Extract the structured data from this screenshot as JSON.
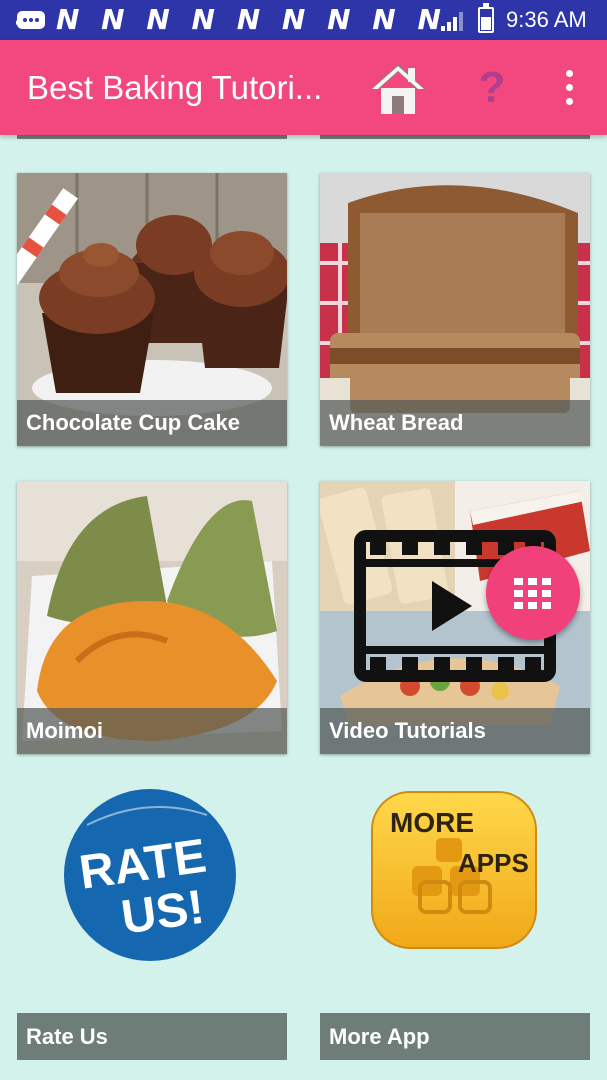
{
  "status_bar": {
    "notification_icons": "N N N N N N N N N",
    "time": "9:36 AM",
    "icons": [
      "message-icon",
      "signal-icon",
      "battery-icon"
    ]
  },
  "app_bar": {
    "title": "Best Baking Tutori...",
    "actions": [
      "home-icon",
      "help-icon",
      "more-options-icon"
    ]
  },
  "grid": [
    {
      "label": "Chocolate Cup Cake"
    },
    {
      "label": "Wheat Bread"
    },
    {
      "label": "Moimoi"
    },
    {
      "label": "Video Tutorials"
    },
    {
      "label": "Rate Us",
      "badge_line1": "RATE",
      "badge_line2": "US!"
    },
    {
      "label": "More App",
      "badge_line1": "MORE",
      "badge_line2": "APPS"
    }
  ],
  "fab": {
    "icon": "grid-menu-icon"
  },
  "colors": {
    "status_bar": "#2d35a8",
    "app_bar": "#f2487d",
    "background": "#d4f2ec",
    "caption_bar": "#6f7d78",
    "fab": "#f0417a"
  }
}
